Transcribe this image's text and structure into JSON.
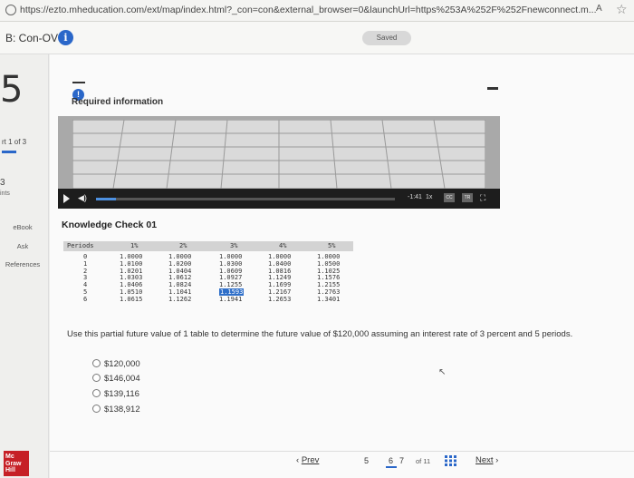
{
  "browser": {
    "url": "https://ezto.mheducation.com/ext/map/index.html?_con=con&external_browser=0&launchUrl=https%253A%252F%252Fnewconnect.m...",
    "reader_label": "A",
    "star_icon": "star-icon"
  },
  "header": {
    "title": "B: Con-OV",
    "saved_label": "Saved"
  },
  "rail": {
    "question_number": "5",
    "part_label": "rt 1 of 3",
    "points_value": "3",
    "points_label": "ints",
    "ebook_label": "eBook",
    "ask_label": "Ask",
    "references_label": "References",
    "logo_text": [
      "Mc",
      "Graw",
      "Hill"
    ]
  },
  "required": {
    "label": "Required information"
  },
  "video": {
    "time": "-1:41",
    "speed": "1x",
    "cc_label": "CC",
    "transcript_label": "TR"
  },
  "knowledge_check": {
    "title": "Knowledge Check 01"
  },
  "fv_table": {
    "headers": [
      "Periods",
      "1%",
      "2%",
      "3%",
      "4%",
      "5%"
    ],
    "rows": [
      [
        "0",
        "1.0000",
        "1.0000",
        "1.0000",
        "1.0000",
        "1.0000"
      ],
      [
        "1",
        "1.0100",
        "1.0200",
        "1.0300",
        "1.0400",
        "1.0500"
      ],
      [
        "2",
        "1.0201",
        "1.0404",
        "1.0609",
        "1.0816",
        "1.1025"
      ],
      [
        "3",
        "1.0303",
        "1.0612",
        "1.0927",
        "1.1249",
        "1.1576"
      ],
      [
        "4",
        "1.0406",
        "1.0824",
        "1.1255",
        "1.1699",
        "1.2155"
      ],
      [
        "5",
        "1.0510",
        "1.1041",
        "1.1593",
        "1.2167",
        "1.2763"
      ],
      [
        "6",
        "1.0615",
        "1.1262",
        "1.1941",
        "1.2653",
        "1.3401"
      ]
    ],
    "highlight": {
      "row": 5,
      "col": 3
    }
  },
  "question": {
    "text": "Use this partial future value of 1 table to determine the future value of $120,000 assuming an interest rate of 3 percent and 5 periods.",
    "options": [
      "$120,000",
      "$146,004",
      "$139,116",
      "$138,912"
    ]
  },
  "footer": {
    "prev_label": "Prev",
    "pages": [
      "5",
      "6",
      "7"
    ],
    "current_page": "6",
    "of_label": "of 11",
    "next_label": "Next"
  }
}
